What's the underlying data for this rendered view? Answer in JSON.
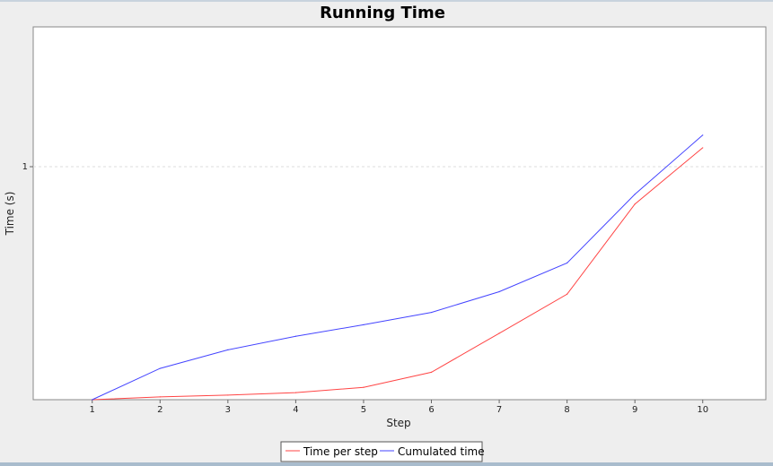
{
  "chart_data": {
    "type": "line",
    "title": "Running Time",
    "xlabel": "Step",
    "ylabel": "Time (s)",
    "x": [
      1,
      2,
      3,
      4,
      5,
      6,
      7,
      8,
      9,
      10
    ],
    "x_ticks": [
      "1",
      "2",
      "3",
      "4",
      "5",
      "6",
      "7",
      "8",
      "9",
      "10"
    ],
    "xlim": [
      0.13,
      10.93
    ],
    "y_scale": "log",
    "y_ticks": [
      {
        "value": 1,
        "label": "1"
      }
    ],
    "grid": true,
    "legend_position": "bottom",
    "series": [
      {
        "name": "Time per step",
        "color": "#ff4444",
        "values": [
          0.0045,
          0.0048,
          0.005,
          0.0053,
          0.006,
          0.0085,
          0.021,
          0.052,
          0.42,
          1.55
        ]
      },
      {
        "name": "Cumulated time",
        "color": "#4444ff",
        "values": [
          0.0045,
          0.0093,
          0.0143,
          0.0196,
          0.0256,
          0.0341,
          0.0551,
          0.107,
          0.527,
          2.077
        ]
      }
    ]
  },
  "colors": {
    "background": "#eeeeee",
    "plot_background": "#ffffff",
    "gridline": "#dddddd"
  }
}
